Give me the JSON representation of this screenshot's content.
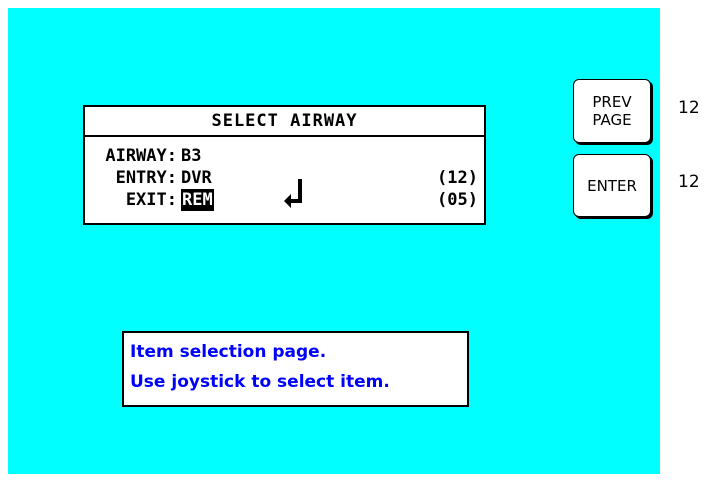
{
  "colors": {
    "screen_background": "#00ffff",
    "panel_background": "#ffffff",
    "help_text": "#0000ff",
    "text": "#000000"
  },
  "dialog": {
    "title": "SELECT AIRWAY",
    "airway_label": "AIRWAY:",
    "airway_value": "B3",
    "entry_label": "ENTRY:",
    "entry_value": "DVR",
    "entry_number": "(12)",
    "exit_label": "EXIT:",
    "exit_value": "REM",
    "exit_number": "(05)",
    "selection_icon": "return-arrow-icon"
  },
  "side_buttons": [
    {
      "label": "PREV\nPAGE",
      "number": "12"
    },
    {
      "label": "ENTER",
      "number": "12"
    }
  ],
  "help": {
    "line1": "Item selection page.",
    "line2": "Use joystick to select item."
  }
}
